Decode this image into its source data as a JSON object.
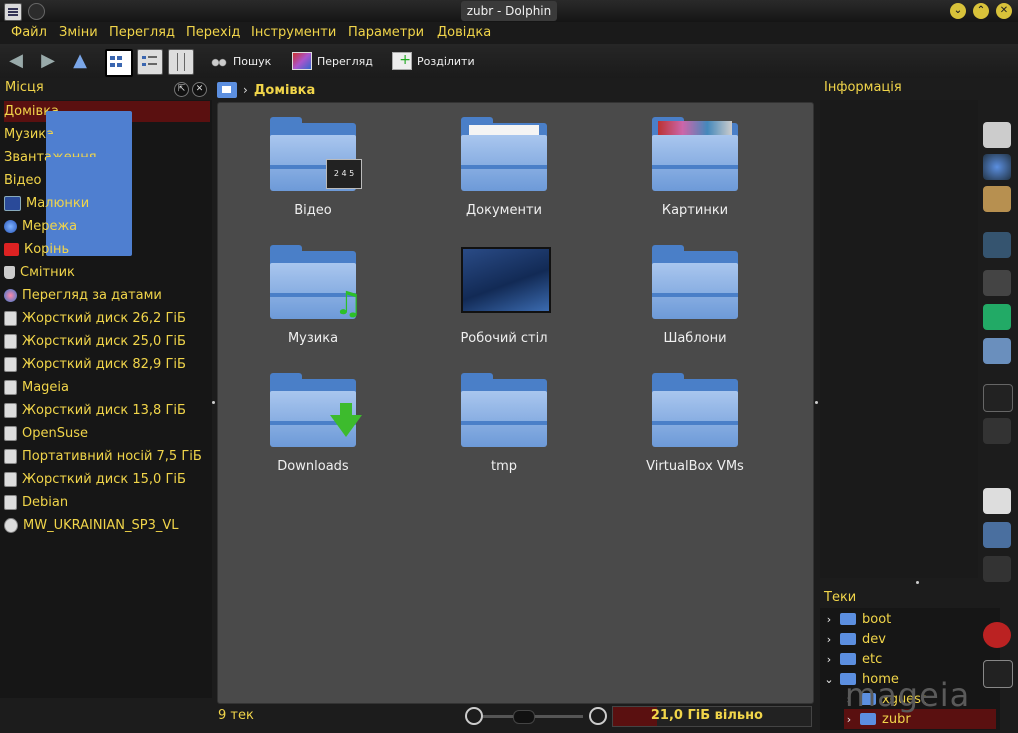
{
  "window": {
    "title": "zubr - Dolphin"
  },
  "menu": [
    "Файл",
    "Зміни",
    "Перегляд",
    "Перехід",
    "Інструменти",
    "Параметри",
    "Довідка"
  ],
  "toolbar": {
    "search_label": "Пошук",
    "preview_label": "Перегляд",
    "split_label": "Розділити"
  },
  "places": {
    "title": "Місця",
    "items": [
      {
        "label": "Домівка",
        "icon": "home-folder-icon"
      },
      {
        "label": "Музика",
        "icon": "music-folder-icon"
      },
      {
        "label": "Звантаження",
        "icon": "downloads-folder-icon"
      },
      {
        "label": "Відео",
        "icon": "video-folder-icon"
      },
      {
        "label": "Малюнки",
        "icon": "pictures-folder-icon"
      },
      {
        "label": "Мережа",
        "icon": "network-icon"
      },
      {
        "label": "Корінь",
        "icon": "root-folder-icon"
      },
      {
        "label": "Смітник",
        "icon": "trash-icon"
      },
      {
        "label": "Перегляд за датами",
        "icon": "timeline-icon"
      },
      {
        "label": "Жорсткий диск 26,2 ГіБ",
        "icon": "hard-drive-icon"
      },
      {
        "label": "Жорсткий диск 25,0 ГіБ",
        "icon": "hard-drive-icon"
      },
      {
        "label": "Жорсткий диск 82,9 ГіБ",
        "icon": "hard-drive-icon"
      },
      {
        "label": "Mageia",
        "icon": "hard-drive-icon"
      },
      {
        "label": "Жорсткий диск 13,8 ГіБ",
        "icon": "hard-drive-icon"
      },
      {
        "label": "OpenSuse",
        "icon": "hard-drive-icon"
      },
      {
        "label": "Портативний носій 7,5 ГіБ",
        "icon": "usb-drive-icon"
      },
      {
        "label": "Жорсткий диск 15,0 ГіБ",
        "icon": "hard-drive-icon"
      },
      {
        "label": "Debian",
        "icon": "hard-drive-icon"
      },
      {
        "label": "MW_UKRAINIAN_SP3_VL",
        "icon": "optical-disc-icon"
      }
    ]
  },
  "breadcrumb": {
    "current": "Домівка"
  },
  "files": [
    {
      "label": "Відео",
      "kind": "video"
    },
    {
      "label": "Документи",
      "kind": "documents"
    },
    {
      "label": "Картинки",
      "kind": "pictures"
    },
    {
      "label": "Музика",
      "kind": "music"
    },
    {
      "label": "Робочий стіл",
      "kind": "desktop"
    },
    {
      "label": "Шаблони",
      "kind": "plain"
    },
    {
      "label": "Downloads",
      "kind": "downloads"
    },
    {
      "label": "tmp",
      "kind": "plain"
    },
    {
      "label": "VirtualBox VMs",
      "kind": "plain"
    }
  ],
  "status": {
    "count": "9 тек",
    "free_space": "21,0 ГіБ вільно",
    "free_fraction": 0.22
  },
  "info_panel": {
    "title": "Інформація"
  },
  "folders_panel": {
    "title": "Теки",
    "items": [
      {
        "label": "boot",
        "expanded": false
      },
      {
        "label": "dev",
        "expanded": false
      },
      {
        "label": "etc",
        "expanded": false
      },
      {
        "label": "home",
        "expanded": true
      },
      {
        "label": "xguest",
        "expanded": false
      },
      {
        "label": "zubr",
        "expanded": false
      }
    ]
  },
  "desktop_watermark": "mageia",
  "colors": {
    "accent": "#f1d54a",
    "selection": "#5a1010",
    "folder_blue": "#4a7fc8"
  }
}
